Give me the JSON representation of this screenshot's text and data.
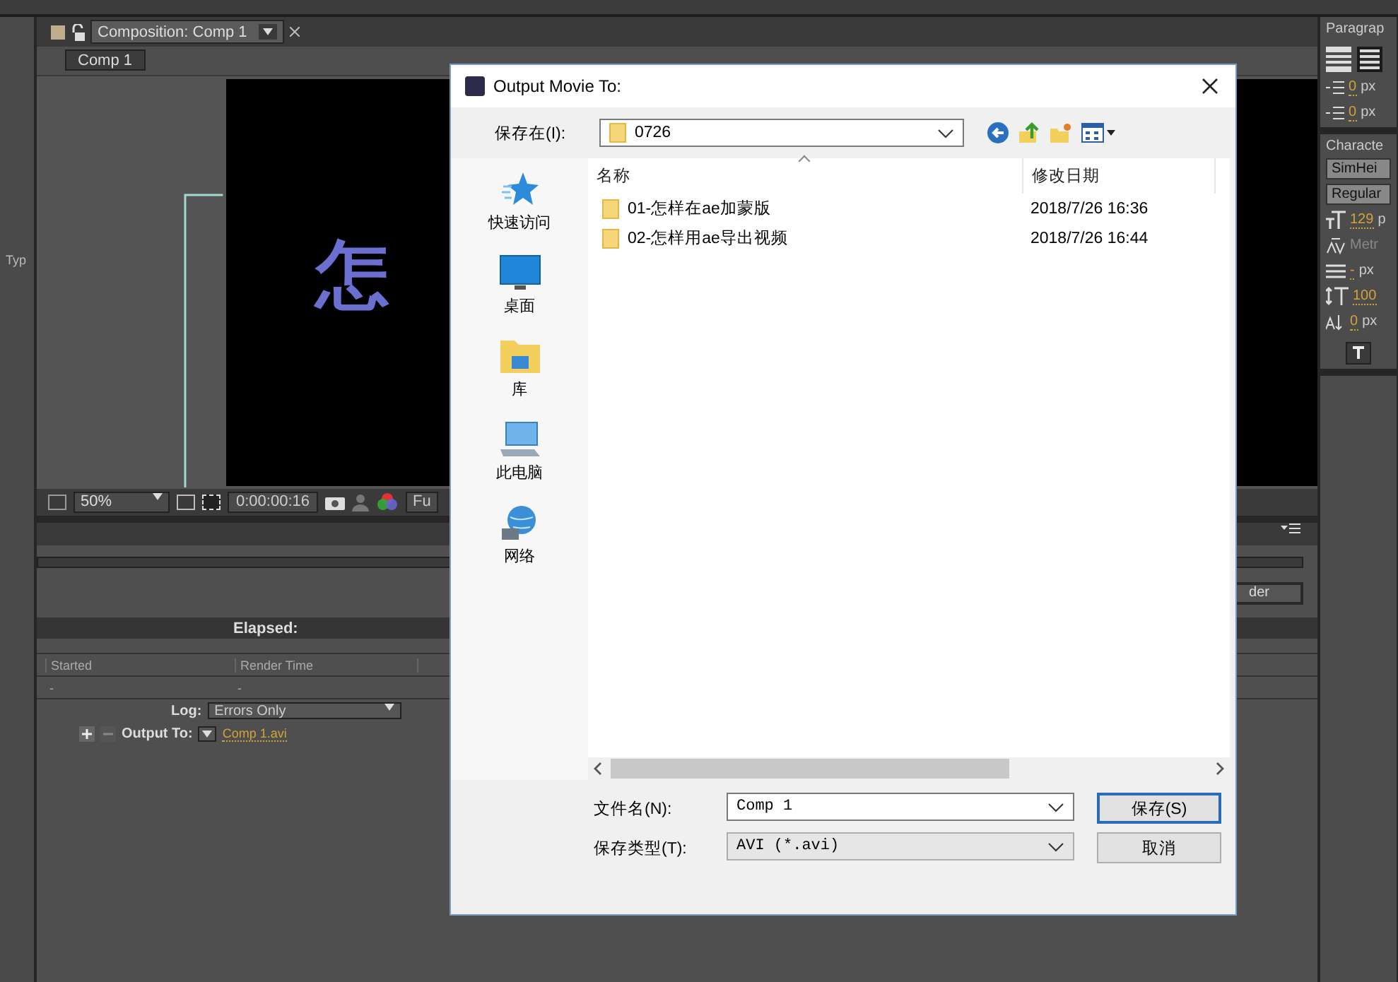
{
  "left_strip": {
    "label": "Typ"
  },
  "composition_panel": {
    "tab": {
      "label": "Composition: Comp 1",
      "selected": true
    },
    "breadcrumb": "Comp 1",
    "canvas_text": "怎",
    "toolbar": {
      "zoom": "50%",
      "timecode": "0:00:00:16",
      "resolution": "Fu"
    }
  },
  "render_queue": {
    "elapsed_label": "Elapsed:",
    "render_button": "der",
    "columns": [
      "Started",
      "Render Time"
    ],
    "row": [
      "-",
      "-"
    ],
    "log": {
      "label": "Log:",
      "value": "Errors Only"
    },
    "output": {
      "label": "Output To:",
      "value": "Comp 1.avi"
    }
  },
  "paragraph_panel": {
    "title": "Paragrap",
    "align_buttons": [
      {
        "selected": false
      },
      {
        "selected": true
      }
    ],
    "indents": [
      {
        "value": "0",
        "unit": "px"
      },
      {
        "value": "0",
        "unit": "px"
      }
    ]
  },
  "character_panel": {
    "title": "Characte",
    "font": "SimHei",
    "style": "Regular",
    "size": {
      "value": "129",
      "unit": "p"
    },
    "kerning": "Metr",
    "leading": {
      "value": "-",
      "unit": "px"
    },
    "vertical_scale": {
      "value": "100"
    },
    "baseline": {
      "value": "0",
      "unit": "px"
    }
  },
  "dialog": {
    "title": "Output Movie To:",
    "save_in_label": "保存在(I):",
    "location": "0726",
    "sidebar": [
      {
        "kind": "star",
        "label": "快速访问"
      },
      {
        "kind": "desktop",
        "label": "桌面"
      },
      {
        "kind": "library",
        "label": "库"
      },
      {
        "kind": "computer",
        "label": "此电脑"
      },
      {
        "kind": "network",
        "label": "网络"
      }
    ],
    "columns": [
      "名称",
      "修改日期"
    ],
    "files": [
      {
        "name": "01-怎样在ae加蒙版",
        "modified": "2018/7/26 16:36"
      },
      {
        "name": "02-怎样用ae导出视频",
        "modified": "2018/7/26 16:44"
      }
    ],
    "filename_label": "文件名(N):",
    "filename": "Comp 1",
    "filetype_label": "保存类型(T):",
    "filetype": "AVI (*.avi)",
    "buttons": [
      "保存(S)",
      "取消"
    ]
  }
}
